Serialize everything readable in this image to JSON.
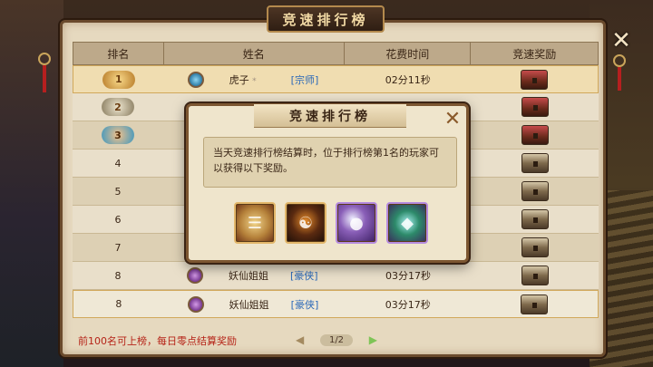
{
  "window": {
    "title": "竞速排行榜",
    "close_glyph": "✕"
  },
  "table": {
    "headers": {
      "rank": "排名",
      "name": "姓名",
      "time": "花费时间",
      "reward": "竞速奖励"
    },
    "rows": [
      {
        "rank": "1",
        "name": "虎子",
        "name_suffix": "*",
        "title": "[宗师]",
        "time": "02分11秒",
        "avatar_color": "blue",
        "reward_icon": "red-chest-icon"
      },
      {
        "rank": "2",
        "name": "",
        "title": "",
        "time": "",
        "avatar_color": "",
        "reward_icon": "red-chest-icon"
      },
      {
        "rank": "3",
        "name": "",
        "title": "",
        "time": "",
        "avatar_color": "",
        "reward_icon": "red-chest-icon"
      },
      {
        "rank": "4",
        "name": "",
        "title": "",
        "time": "",
        "avatar_color": "",
        "reward_icon": "chest-icon"
      },
      {
        "rank": "5",
        "name": "",
        "title": "",
        "time": "",
        "avatar_color": "",
        "reward_icon": "chest-icon"
      },
      {
        "rank": "6",
        "name": "",
        "title": "",
        "time": "",
        "avatar_color": "",
        "reward_icon": "chest-icon"
      },
      {
        "rank": "7",
        "name": "",
        "title": "",
        "time": "",
        "avatar_color": "",
        "reward_icon": "chest-icon"
      },
      {
        "rank": "8",
        "name": "妖仙姐姐",
        "title": "[豪侠]",
        "time": "03分17秒",
        "avatar_color": "purple",
        "reward_icon": "chest-icon"
      },
      {
        "rank": "8",
        "name": "妖仙姐姐",
        "title": "[豪侠]",
        "time": "03分17秒",
        "avatar_color": "purple",
        "reward_icon": "chest-icon"
      }
    ]
  },
  "footer": {
    "notice": "前100名可上榜，每日零点结算奖励",
    "page": "1/2",
    "prev_glyph": "◀",
    "next_glyph": "▶"
  },
  "popup": {
    "title": "竞速排行榜",
    "close_glyph": "✕",
    "description": "当天竞速排行榜结算时，位于排行榜第1名的玩家可以获得以下奖励。",
    "items": [
      {
        "icon": "scroll-icon"
      },
      {
        "icon": "warrior-portrait-icon"
      },
      {
        "icon": "pearls-icon"
      },
      {
        "icon": "treasure-chest-icon"
      }
    ]
  },
  "colors": {
    "notice_red": "#b52317",
    "title_blue": "#2a68b8",
    "panel_bg": "#e6d9bf"
  }
}
